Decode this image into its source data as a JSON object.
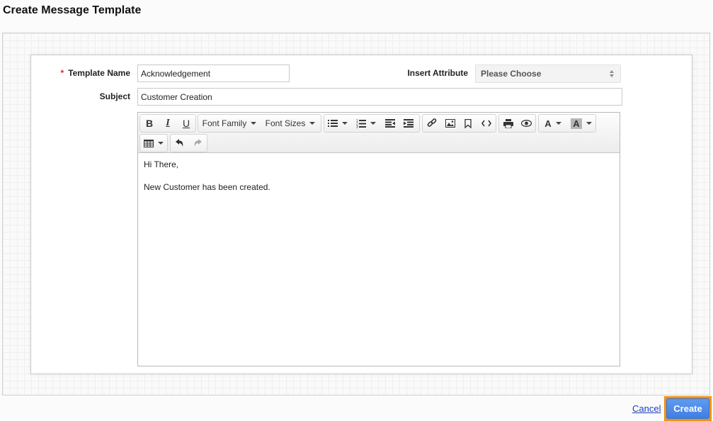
{
  "page": {
    "title": "Create Message Template"
  },
  "form": {
    "template_name": {
      "label": "Template Name",
      "required_marker": "*",
      "value": "Acknowledgement"
    },
    "insert_attribute": {
      "label": "Insert Attribute",
      "selected": "Please Choose"
    },
    "subject": {
      "label": "Subject",
      "value": "Customer Creation"
    }
  },
  "editor": {
    "toolbar": {
      "bold": "B",
      "italic": "I",
      "underline": "U",
      "font_family": "Font Family",
      "font_sizes": "Font Sizes",
      "text_color": "A",
      "background_color": "A"
    },
    "content": [
      "Hi There,",
      "New Customer has been created."
    ]
  },
  "footer": {
    "cancel_label": "Cancel",
    "create_label": "Create"
  },
  "colors": {
    "primary_button": "#4a87ea",
    "focus_outline": "#f2910f",
    "required": "#d9232e",
    "link": "#1a3fbf"
  }
}
